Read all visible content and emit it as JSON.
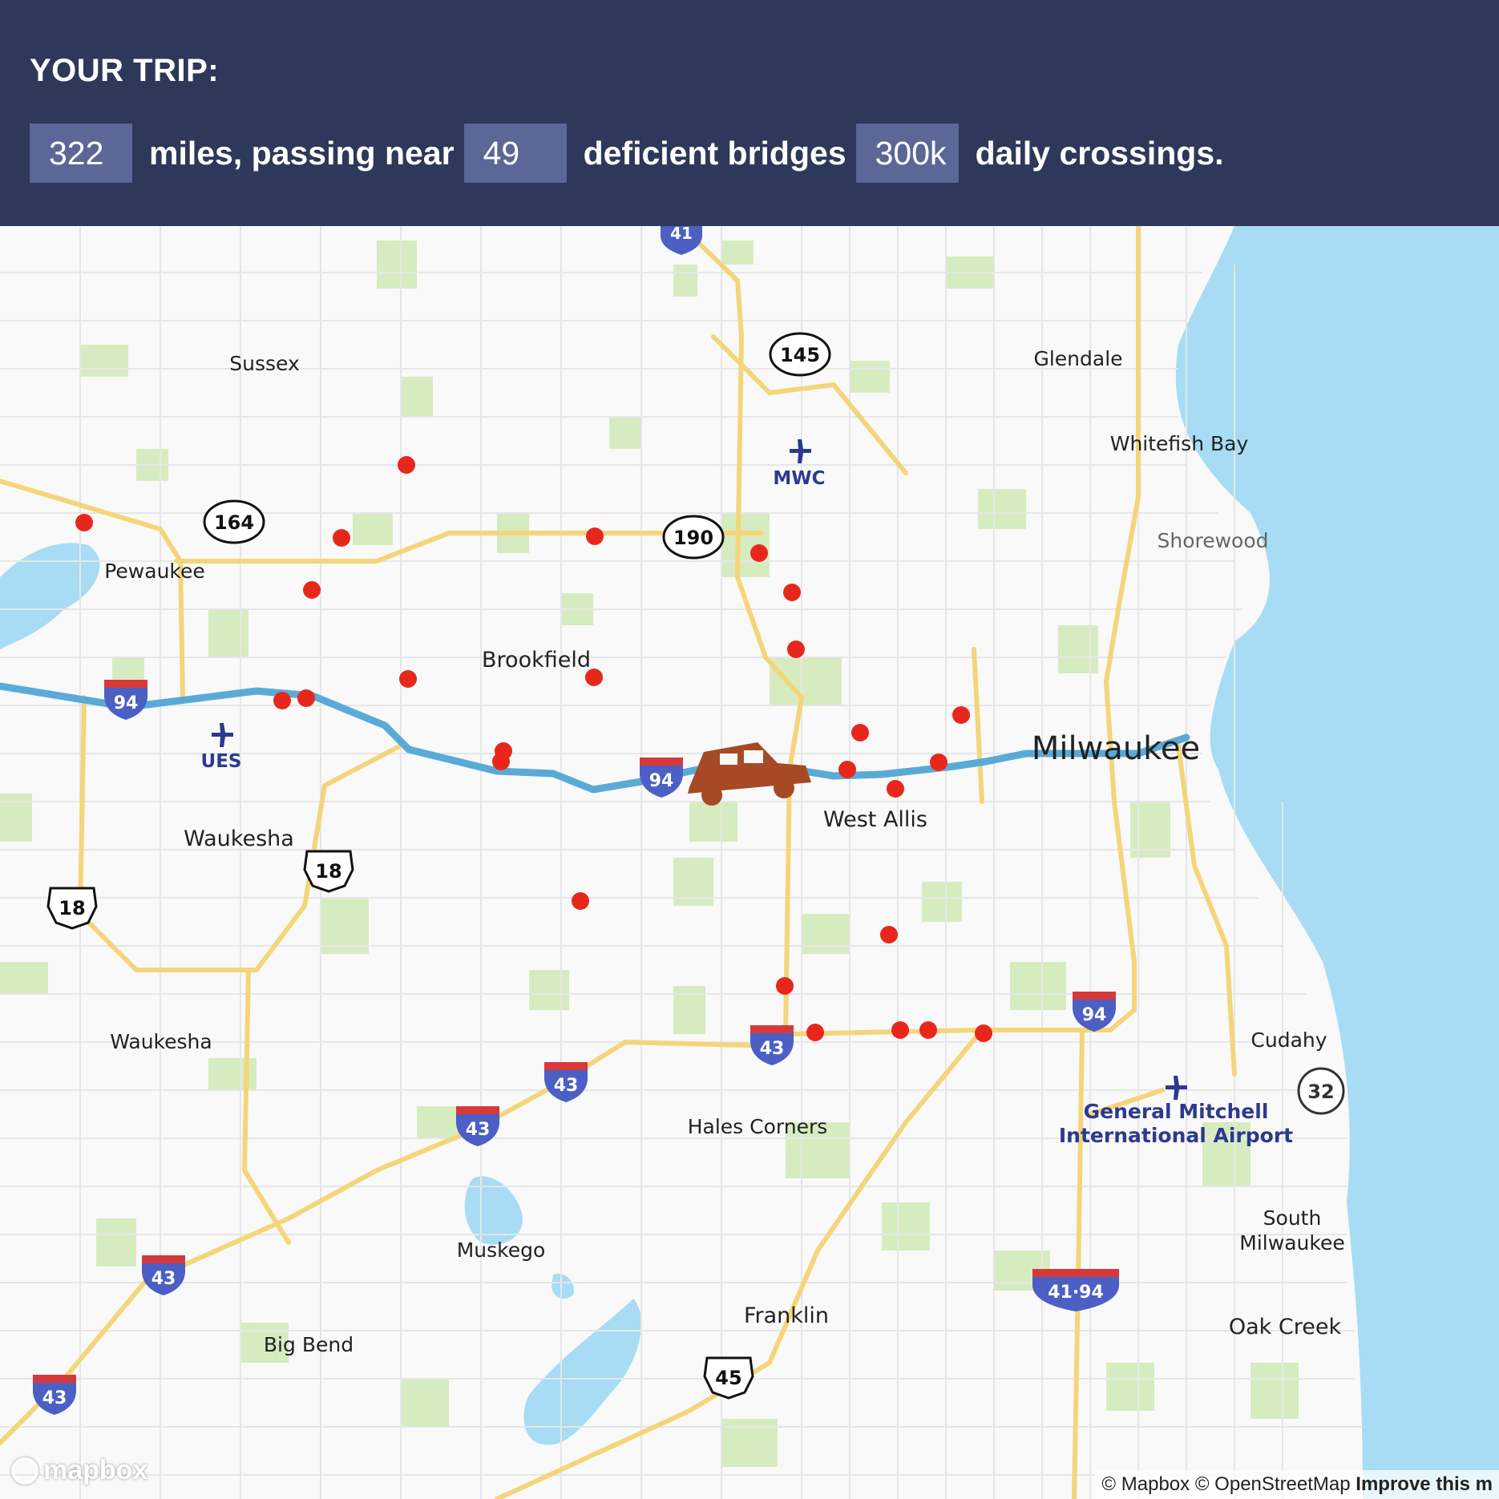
{
  "header": {
    "title": "YOUR TRIP:",
    "miles_value": "322",
    "miles_phrase": "miles, passing near",
    "bridges_value": "49",
    "bridges_phrase": "deficient bridges",
    "crossings_value": "300k",
    "crossings_phrase": "daily crossings."
  },
  "colors": {
    "header_bg": "#2d385a",
    "stat_bg": "#5a6797",
    "route": "#5aaad8",
    "bridge_marker": "#e8271c",
    "car": "#a64a26",
    "water": "#a7dcf4",
    "park": "#d6ecc0",
    "highway": "#f5d57a"
  },
  "places": {
    "sussex": "Sussex",
    "pewaukee": "Pewaukee",
    "brookfield": "Brookfield",
    "waukesha_city": "Waukesha",
    "waukesha_south": "Waukesha",
    "glendale": "Glendale",
    "whitefish_bay": "Whitefish Bay",
    "shorewood": "Shorewood",
    "milwaukee": "Milwaukee",
    "west_allis": "West Allis",
    "hales_corners": "Hales Corners",
    "muskego": "Muskego",
    "franklin": "Franklin",
    "big_bend": "Big Bend",
    "cudahy": "Cudahy",
    "south_milwaukee_1": "South",
    "south_milwaukee_2": "Milwaukee",
    "oak_creek": "Oak Creek",
    "airport_gm_1": "General Mitchell",
    "airport_gm_2": "International Airport"
  },
  "airports": {
    "mwc": "MWC",
    "ues": "UES"
  },
  "shields": {
    "i41": "41",
    "sr145": "145",
    "sr164": "164",
    "sr190": "190",
    "i94_west": "94",
    "i94_mid": "94",
    "i94_south": "94",
    "us18_a": "18",
    "us18_b": "18",
    "i43_a": "43",
    "i43_b": "43",
    "i43_c": "43",
    "i43_d": "43",
    "i43_e": "43",
    "i41_94": "41·94",
    "sr32": "32",
    "us45": "45"
  },
  "map": {
    "route_label": "I-94 trip route",
    "bridge_count_shown": 29
  },
  "attribution": {
    "mapbox": "© Mapbox",
    "osm": "© OpenStreetMap",
    "improve": "Improve this m",
    "logo": "mapbox"
  }
}
